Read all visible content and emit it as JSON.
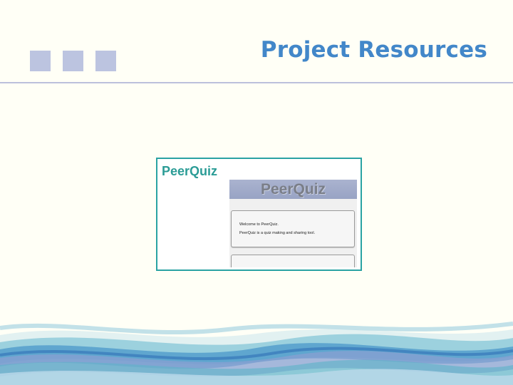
{
  "slide": {
    "title": "Project Resources"
  },
  "resource": {
    "title": "PeerQuiz",
    "screenshot": {
      "header": "PeerQuiz",
      "welcome_line": "Welcome to PeerQuiz.",
      "description_line": "PeerQuiz is a quiz making and sharing tool."
    }
  },
  "colors": {
    "background": "#fffff6",
    "title": "#4287c9",
    "squares": "#bcc4e0",
    "card_border": "#2aa3a3",
    "card_title": "#2b9c96"
  }
}
